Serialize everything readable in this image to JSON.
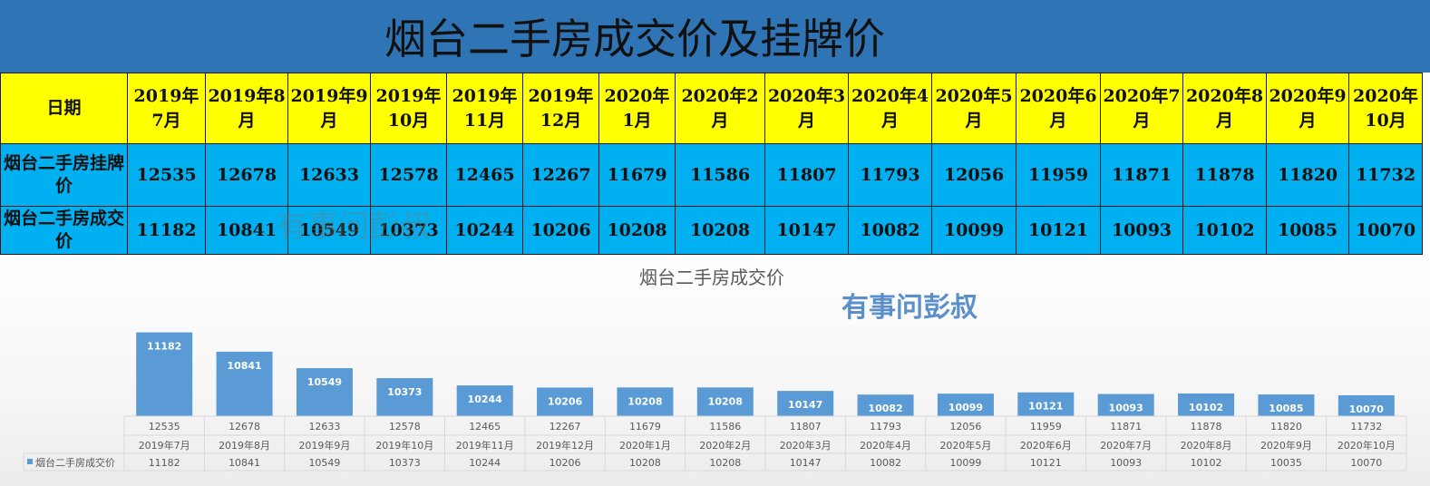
{
  "header": {
    "title": "烟台二手房成交价及挂牌价"
  },
  "table": {
    "date_label": "日期",
    "months": [
      "2019年7月",
      "2019年8月",
      "2019年9月",
      "2019年10月",
      "2019年11月",
      "2019年12月",
      "2020年1月",
      "2020年2月",
      "2020年3月",
      "2020年4月",
      "2020年5月",
      "2020年6月",
      "2020年7月",
      "2020年8月",
      "2020年9月",
      "2020年10月"
    ],
    "rows": [
      {
        "label": "烟台二手房挂牌价",
        "values": [
          12535,
          12678,
          12633,
          12578,
          12465,
          12267,
          11679,
          11586,
          11807,
          11793,
          12056,
          11959,
          11871,
          11878,
          11820,
          11732
        ]
      },
      {
        "label": "烟台二手房成交价",
        "values": [
          11182,
          10841,
          10549,
          10373,
          10244,
          10206,
          10208,
          10208,
          10147,
          10082,
          10099,
          10121,
          10093,
          10102,
          10085,
          10070
        ]
      }
    ]
  },
  "watermark": "有事问彭叔",
  "chart_data": {
    "type": "bar",
    "title": "烟台二手房成交价",
    "categories": [
      "2019年7月",
      "2019年8月",
      "2019年9月",
      "2019年10月",
      "2019年11月",
      "2019年12月",
      "2020年1月",
      "2020年2月",
      "2020年3月",
      "2020年4月",
      "2020年5月",
      "2020年6月",
      "2020年7月",
      "2020年8月",
      "2020年9月",
      "2020年10月"
    ],
    "secondary_labels": [
      "12535",
      "12678",
      "12633",
      "12578",
      "12465",
      "12267",
      "11679",
      "11586",
      "11807",
      "11793",
      "12056",
      "11959",
      "11871",
      "11878",
      "11820",
      "11732"
    ],
    "series": [
      {
        "name": "烟台二手房成交价",
        "values": [
          11182,
          10841,
          10549,
          10373,
          10244,
          10206,
          10208,
          10208,
          10147,
          10082,
          10099,
          10121,
          10093,
          10102,
          10085,
          10070
        ]
      }
    ],
    "data_table_values": [
      "11182",
      "10841",
      "10549",
      "10373",
      "10244",
      "10206",
      "10208",
      "10208",
      "10147",
      "10082",
      "10099",
      "10121",
      "10093",
      "10102",
      "10035",
      "10070"
    ],
    "ylim": [
      9700,
      11400
    ],
    "legend_placement": "data-table",
    "bar_color": "#5b9bd5",
    "grid": false
  }
}
